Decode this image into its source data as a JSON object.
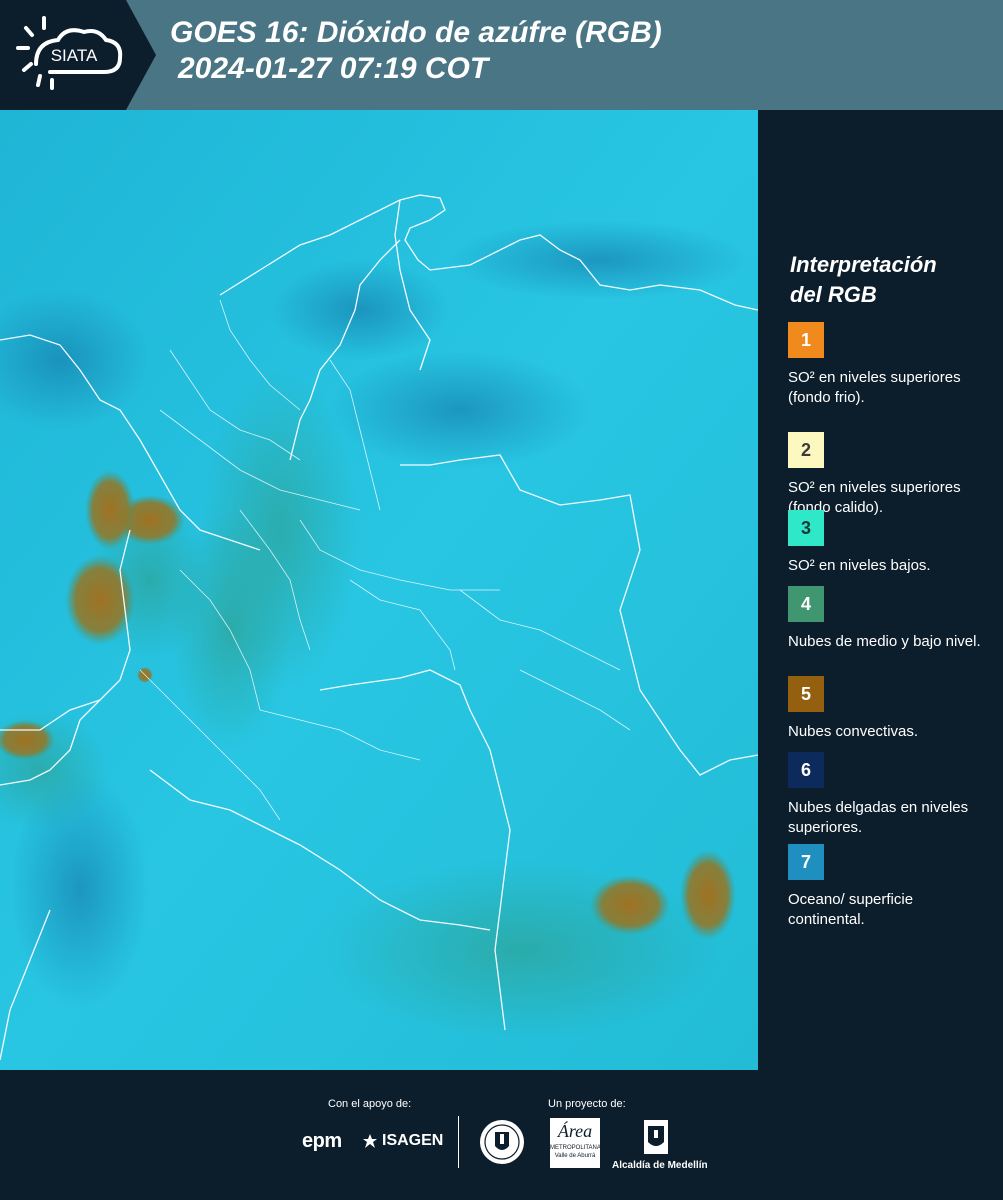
{
  "header": {
    "logo_text": "SIATA",
    "title_line1": "GOES 16: Dióxido de azúfre (RGB)",
    "title_line2": "2024-01-27 07:19 COT"
  },
  "legend": {
    "title_line1": "Interpretación",
    "title_line2": "del RGB",
    "items": [
      {
        "num": "1",
        "color": "#f08a1c",
        "num_color": "#ffffff",
        "text": "SO² en niveles superiores (fondo frio)."
      },
      {
        "num": "2",
        "color": "#fdf7c0",
        "num_color": "#3a3a3a",
        "text": "SO² en niveles superiores (fondo calido)."
      },
      {
        "num": "3",
        "color": "#2ee8c8",
        "num_color": "#1a3a3a",
        "text": "SO² en niveles bajos."
      },
      {
        "num": "4",
        "color": "#3f9670",
        "num_color": "#ffffff",
        "text": "Nubes de medio y bajo nivel."
      },
      {
        "num": "5",
        "color": "#94600f",
        "num_color": "#ffffff",
        "text": "Nubes convectivas."
      },
      {
        "num": "6",
        "color": "#0d2a5c",
        "num_color": "#ffffff",
        "text": "Nubes delgadas en niveles superiores."
      },
      {
        "num": "7",
        "color": "#1f8fc0",
        "num_color": "#ffffff",
        "text": "Oceano/ superficie continental."
      }
    ]
  },
  "footer": {
    "support_label": "Con el apoyo de:",
    "project_label": "Un proyecto de:",
    "epm": "epm",
    "isagen": "ISAGEN",
    "area_name": "Área",
    "area_sub1": "METROPOLITANA",
    "area_sub2": "Valle de Aburrá",
    "alcaldia": "Alcaldía de Medellín"
  }
}
